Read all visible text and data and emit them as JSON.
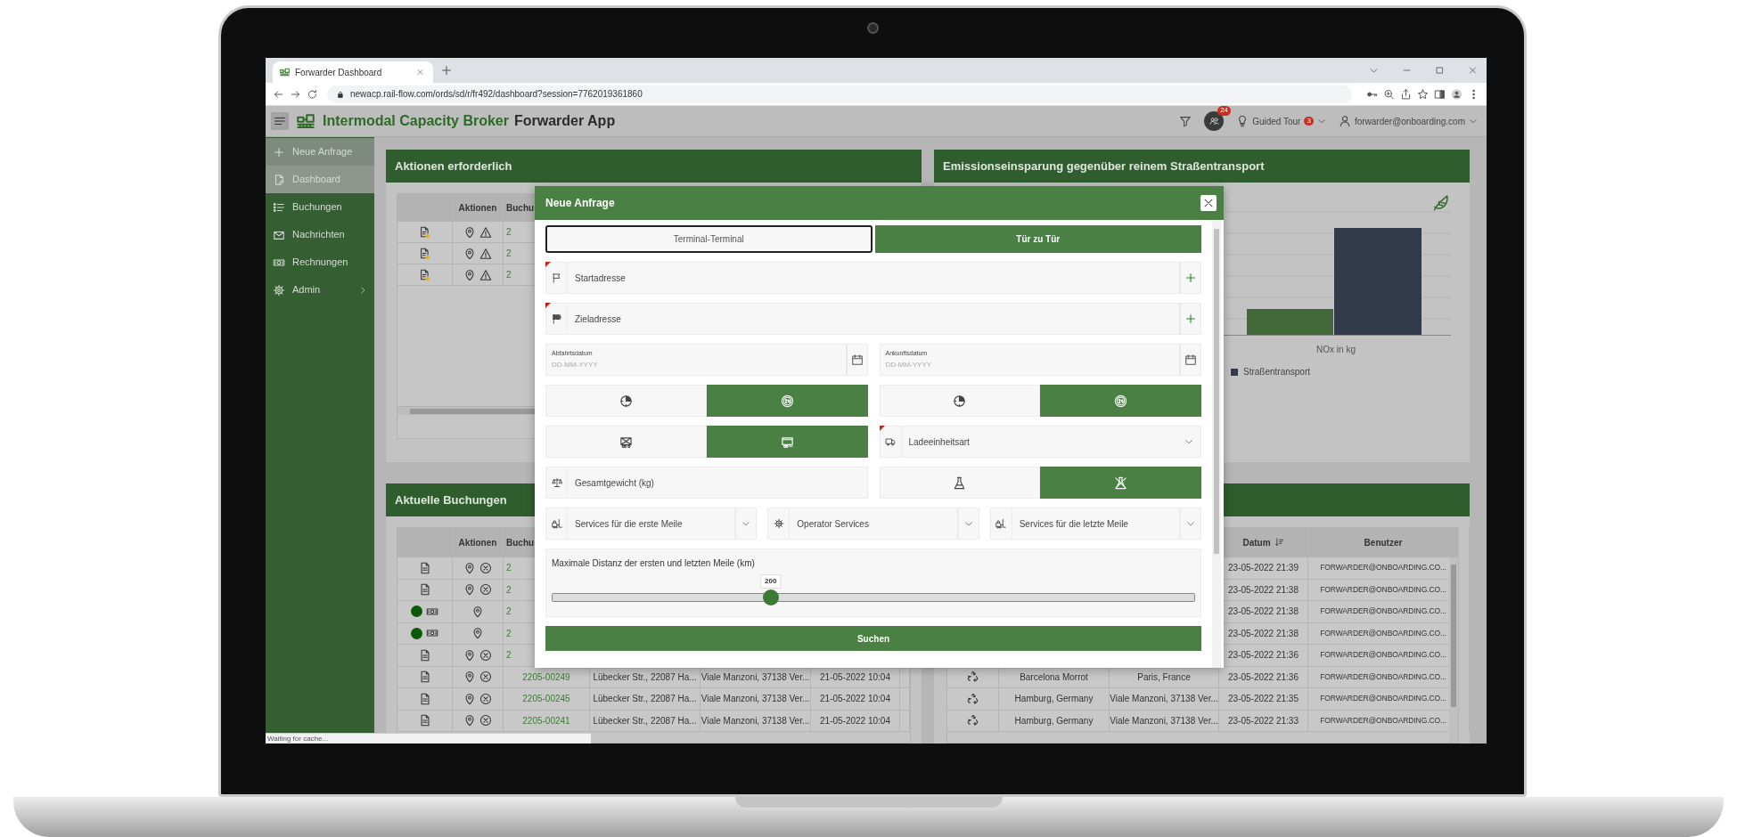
{
  "browser": {
    "tab_title": "Forwarder Dashboard",
    "url": "newacp.rail-flow.com/ords/sd/r/fr492/dashboard?session=7762019361860"
  },
  "header": {
    "brand": "Intermodal Capacity Broker",
    "app": "Forwarder App",
    "notifications": "24",
    "tour": "Guided Tour",
    "tour_count": "3",
    "user": "forwarder@onboarding.com"
  },
  "sidebar": {
    "items": [
      {
        "label": "Neue Anfrage",
        "selected": false,
        "highlighted": true,
        "has_submenu": false
      },
      {
        "label": "Dashboard",
        "selected": true,
        "highlighted": false,
        "has_submenu": false
      },
      {
        "label": "Buchungen",
        "selected": false,
        "highlighted": false,
        "has_submenu": false
      },
      {
        "label": "Nachrichten",
        "selected": false,
        "highlighted": false,
        "has_submenu": false
      },
      {
        "label": "Rechnungen",
        "selected": false,
        "highlighted": false,
        "has_submenu": false
      },
      {
        "label": "Admin",
        "selected": false,
        "highlighted": false,
        "has_submenu": true
      }
    ]
  },
  "actions_panel": {
    "title": "Aktionen erforderlich",
    "columns": [
      "Aktionen",
      "Buchu"
    ],
    "rows": [
      {
        "booking": "2"
      },
      {
        "booking": "2"
      },
      {
        "booking": "2"
      }
    ]
  },
  "emissions_panel": {
    "title": "Emissionseinsparung gegenüber reinem Straßentransport",
    "x_label": "NOx in kg",
    "legend": [
      {
        "label": "Straßentransport",
        "color": "#323a4c"
      }
    ]
  },
  "bookings_panel": {
    "title": "Aktuelle Buchungen",
    "columns": [
      "Aktionen",
      "Buchu"
    ],
    "rows": [
      {
        "kind": "document",
        "booking": "2"
      },
      {
        "kind": "document",
        "booking": "2"
      },
      {
        "kind": "paid",
        "booking": "2"
      },
      {
        "kind": "paid",
        "booking": "2"
      },
      {
        "kind": "document",
        "booking": "2"
      },
      {
        "kind": "document",
        "booking": "2205-00249",
        "start": "Lübecker Str., 22087 Ha...",
        "destination": "Viale Manzoni, 37138 Ver...",
        "date": "21-05-2022 10:04"
      },
      {
        "kind": "document",
        "booking": "2205-00245",
        "start": "Lübecker Str., 22087 Ha...",
        "destination": "Viale Manzoni, 37138 Ver...",
        "date": "21-05-2022 10:04"
      },
      {
        "kind": "document",
        "booking": "2205-00241",
        "start": "Lübecker Str., 22087 Ha...",
        "destination": "Viale Manzoni, 37138 Ver...",
        "date": "21-05-2022 10:04"
      }
    ]
  },
  "requests_panel": {
    "columns": [
      {
        "label": "Datum",
        "sorted": true
      },
      {
        "label": "Benutzer"
      }
    ],
    "rows": [
      {
        "date": "23-05-2022 21:39",
        "user": "FORWARDER@ONBOARDING.CO..."
      },
      {
        "date": "23-05-2022 21:38",
        "user": "FORWARDER@ONBOARDING.CO..."
      },
      {
        "date": "23-05-2022 21:38",
        "user": "FORWARDER@ONBOARDING.CO..."
      },
      {
        "date": "23-05-2022 21:38",
        "user": "FORWARDER@ONBOARDING.CO..."
      },
      {
        "date": "23-05-2022 21:36",
        "user": "FORWARDER@ONBOARDING.CO..."
      },
      {
        "origin": "Barcelona Morrot",
        "destination": "Paris, France",
        "date": "23-05-2022 21:36",
        "user": "FORWARDER@ONBOARDING.CO..."
      },
      {
        "origin": "Hamburg, Germany",
        "destination": "Viale Manzoni, 37138 Ver...",
        "date": "23-05-2022 21:35",
        "user": "FORWARDER@ONBOARDING.CO..."
      },
      {
        "origin": "Hamburg, Germany",
        "destination": "Viale Manzoni, 37138 Ver...",
        "date": "23-05-2022 21:33",
        "user": "FORWARDER@ONBOARDING.CO..."
      }
    ]
  },
  "modal": {
    "title": "Neue Anfrage",
    "mode_tabs": [
      {
        "label": "Terminal-Terminal",
        "selected": false
      },
      {
        "label": "Tür zu Tür",
        "selected": true
      }
    ],
    "start": {
      "placeholder": "Startadresse",
      "required": true
    },
    "destination": {
      "placeholder": "Zieladresse",
      "required": true
    },
    "departure": {
      "label": "Abfahrtsdatum",
      "placeholder": "DD-MM-YYYY"
    },
    "arrival": {
      "label": "Ankunftsdatum",
      "placeholder": "DD-MM-YYYY"
    },
    "departure_time": [
      {
        "selected": false
      },
      {
        "selected": true
      }
    ],
    "arrival_time": [
      {
        "selected": false
      },
      {
        "selected": true
      }
    ],
    "transport": [
      {
        "selected": false
      },
      {
        "selected": true
      }
    ],
    "load_unit": {
      "placeholder": "Ladeeinheitsart",
      "required": true
    },
    "weight": {
      "placeholder": "Gesamtgewicht (kg)"
    },
    "hazard": [
      {
        "selected": false
      },
      {
        "selected": true
      }
    ],
    "services": [
      {
        "placeholder": "Services für die erste Meile"
      },
      {
        "placeholder": "Operator Services"
      },
      {
        "placeholder": "Services für die letzte Meile"
      }
    ],
    "distance": {
      "label": "Maximale Distanz der ersten und letzten Meile (km)",
      "value": "200",
      "level": 0.34
    },
    "search_button": "Suchen"
  },
  "status_bar": "Waiting for cache..."
}
